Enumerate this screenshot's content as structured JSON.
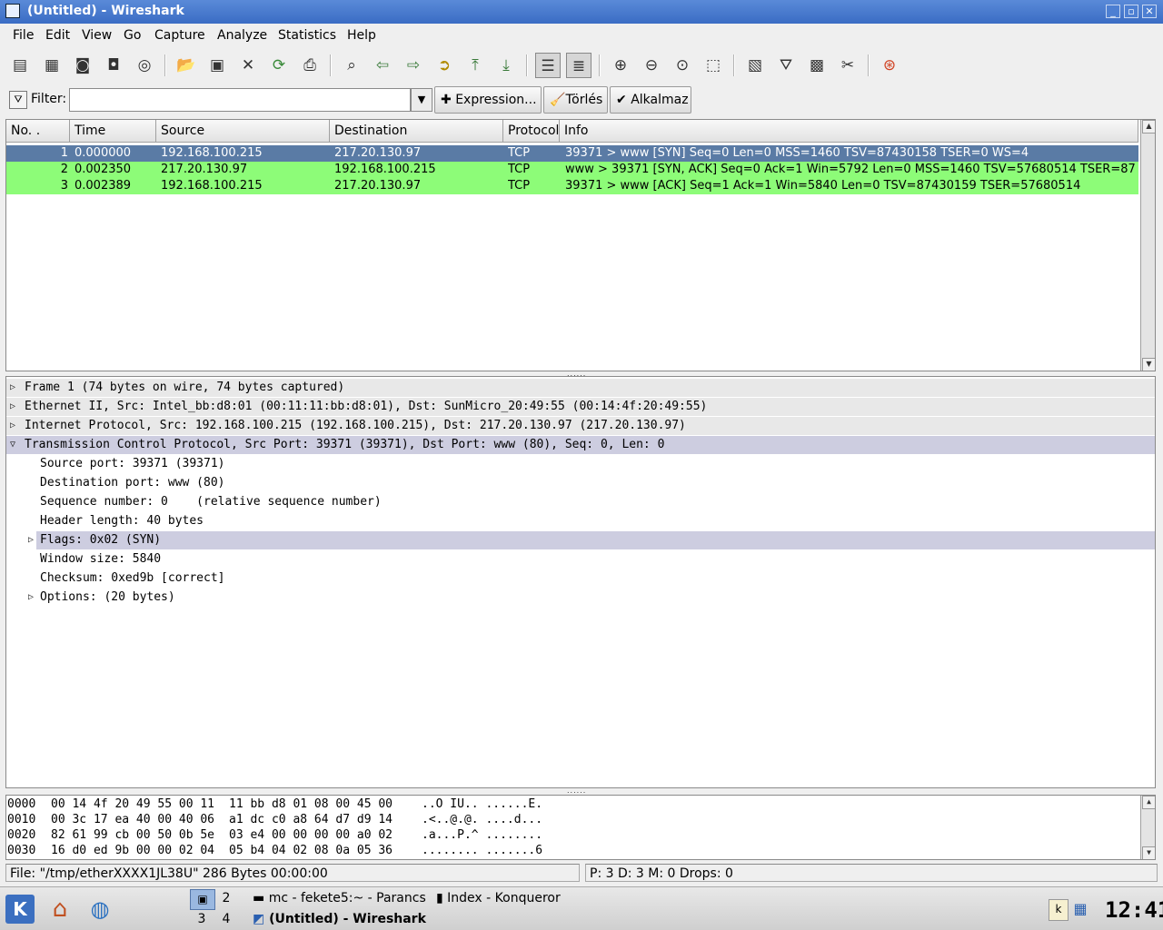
{
  "window": {
    "title": "(Untitled) - Wireshark",
    "controls": [
      "_",
      "▫",
      "✕"
    ]
  },
  "menu": [
    "File",
    "Edit",
    "View",
    "Go",
    "Capture",
    "Analyze",
    "Statistics",
    "Help"
  ],
  "toolbar": {
    "icons": [
      "capture-interfaces-icon",
      "capture-options-icon",
      "capture-start-icon",
      "capture-stop-icon",
      "capture-restart-icon",
      "open-file-icon",
      "save-file-icon",
      "close-file-icon",
      "reload-icon",
      "print-icon",
      "find-packet-icon",
      "go-back-icon",
      "go-forward-icon",
      "go-to-packet-icon",
      "go-first-icon",
      "go-last-icon",
      "colorize-icon",
      "auto-scroll-icon",
      "zoom-in-icon",
      "zoom-out-icon",
      "zoom-100-icon",
      "resize-columns-icon",
      "capture-filters-icon",
      "display-filters-icon",
      "coloring-rules-icon",
      "preferences-icon",
      "help-icon"
    ]
  },
  "filter": {
    "label": "Filter:",
    "value": "",
    "expression_label": "Expression...",
    "clear_label": "Törlés",
    "apply_label": "Alkalmaz"
  },
  "packet_list": {
    "columns": [
      "No. .",
      "Time",
      "Source",
      "Destination",
      "Protocol",
      "Info"
    ],
    "rows": [
      {
        "no": "1",
        "time": "0.000000",
        "source": "192.168.100.215",
        "destination": "217.20.130.97",
        "protocol": "TCP",
        "info": "39371 > www [SYN] Seq=0 Len=0 MSS=1460 TSV=87430158 TSER=0 WS=4",
        "selected": true
      },
      {
        "no": "2",
        "time": "0.002350",
        "source": "217.20.130.97",
        "destination": "192.168.100.215",
        "protocol": "TCP",
        "info": "www > 39371 [SYN, ACK] Seq=0 Ack=1 Win=5792 Len=0 MSS=1460 TSV=57680514 TSER=87",
        "selected": false
      },
      {
        "no": "3",
        "time": "0.002389",
        "source": "192.168.100.215",
        "destination": "217.20.130.97",
        "protocol": "TCP",
        "info": "39371 > www [ACK] Seq=1 Ack=1 Win=5840 Len=0 TSV=87430159 TSER=57680514",
        "selected": false
      }
    ],
    "colors": {
      "selected_bg": "#5a7ba5",
      "selected_fg": "#ffffff",
      "tcp_bg": "#8dfc78"
    }
  },
  "details": {
    "rows": [
      {
        "text": "Frame 1 (74 bytes on wire, 74 bytes captured)",
        "level": 0,
        "expander": "closed",
        "highlight": "section"
      },
      {
        "text": "Ethernet II, Src: Intel_bb:d8:01 (00:11:11:bb:d8:01), Dst: SunMicro_20:49:55 (00:14:4f:20:49:55)",
        "level": 0,
        "expander": "closed",
        "highlight": "section"
      },
      {
        "text": "Internet Protocol, Src: 192.168.100.215 (192.168.100.215), Dst: 217.20.130.97 (217.20.130.97)",
        "level": 0,
        "expander": "closed",
        "highlight": "section"
      },
      {
        "text": "Transmission Control Protocol, Src Port: 39371 (39371), Dst Port: www (80), Seq: 0, Len: 0",
        "level": 0,
        "expander": "open",
        "highlight": "selected"
      },
      {
        "text": "Source port: 39371 (39371)",
        "level": 1,
        "expander": "none",
        "highlight": "none"
      },
      {
        "text": "Destination port: www (80)",
        "level": 1,
        "expander": "none",
        "highlight": "none"
      },
      {
        "text": "Sequence number: 0    (relative sequence number)",
        "level": 1,
        "expander": "none",
        "highlight": "none"
      },
      {
        "text": "Header length: 40 bytes",
        "level": 1,
        "expander": "none",
        "highlight": "none"
      },
      {
        "text": "Flags: 0x02 (SYN)",
        "level": 1,
        "expander": "closed",
        "highlight": "selected"
      },
      {
        "text": "Window size: 5840",
        "level": 1,
        "expander": "none",
        "highlight": "none"
      },
      {
        "text": "Checksum: 0xed9b [correct]",
        "level": 1,
        "expander": "none",
        "highlight": "none"
      },
      {
        "text": "Options: (20 bytes)",
        "level": 1,
        "expander": "closed",
        "highlight": "none"
      }
    ],
    "colors": {
      "section_bg": "#e8e8e8",
      "selected_bg": "#cdcde0"
    }
  },
  "hex": {
    "rows": [
      {
        "offset": "0000",
        "bytes1": "00 14 4f 20 49 55 00 11",
        "bytes2": "11 bb d8 01 08 00 45 00",
        "ascii": "..O IU.. ......E."
      },
      {
        "offset": "0010",
        "bytes1": "00 3c 17 ea 40 00 40 06",
        "bytes2": "a1 dc c0 a8 64 d7 d9 14",
        "ascii": ".<..@.@. ....d..."
      },
      {
        "offset": "0020",
        "bytes1": "82 61 99 cb 00 50 0b 5e",
        "bytes2": "03 e4 00 00 00 00 a0 02",
        "ascii": ".a...P.^ ........"
      },
      {
        "offset": "0030",
        "bytes1": "16 d0 ed 9b 00 00 02 04",
        "bytes2": "05 b4 04 02 08 0a 05 36",
        "ascii": "........ .......6"
      }
    ]
  },
  "status": {
    "file": "File: \"/tmp/etherXXXX1JL38U\" 286 Bytes 00:00:00",
    "packets": "P: 3 D: 3 M: 0 Drops: 0"
  },
  "taskbar": {
    "desktops": [
      "1",
      "2",
      "3",
      "4"
    ],
    "tasks": [
      {
        "label": "mc - fekete5:~ - Parancs",
        "icon": "terminal-icon"
      },
      {
        "label": "Index - Konqueror",
        "icon": "konqueror-icon"
      },
      {
        "label": "(Untitled) - Wireshark",
        "icon": "wireshark-icon"
      }
    ],
    "clock": "12:41"
  }
}
